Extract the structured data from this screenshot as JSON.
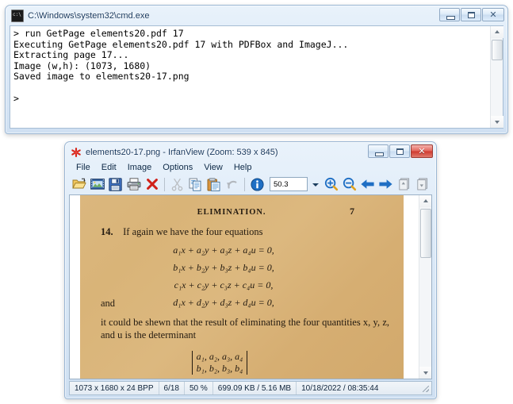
{
  "cmd_window": {
    "title": "C:\\Windows\\system32\\cmd.exe",
    "icon": "cmd-console-icon",
    "buttons": {
      "minimize": "–",
      "maximize": "☐",
      "close": "✕"
    },
    "console_text": "> run GetPage elements20.pdf 17\nExecuting GetPage elements20.pdf 17 with PDFBox and ImageJ...\nExtracting page 17...\nImage (w,h): (1073, 1680)\nSaved image to elements20-17.png\n\n>"
  },
  "irfanview_window": {
    "title": "elements20-17.png - IrfanView (Zoom: 539 x 845)",
    "icon": "irfanview-starburst-icon",
    "buttons": {
      "minimize": "–",
      "maximize": "☐",
      "close": "✕"
    },
    "menu": [
      {
        "label": "File"
      },
      {
        "label": "Edit"
      },
      {
        "label": "Image"
      },
      {
        "label": "Options"
      },
      {
        "label": "View"
      },
      {
        "label": "Help"
      }
    ],
    "toolbar": {
      "zoom_value": "50.3",
      "buttons": [
        {
          "name": "open-icon"
        },
        {
          "name": "thumbnails-icon"
        },
        {
          "name": "save-icon"
        },
        {
          "name": "print-icon"
        },
        {
          "name": "delete-icon"
        },
        {
          "name": "cut-icon"
        },
        {
          "name": "copy-icon"
        },
        {
          "name": "paste-icon"
        },
        {
          "name": "undo-icon"
        },
        {
          "name": "info-icon"
        },
        {
          "name": "zoom-in-icon"
        },
        {
          "name": "zoom-out-icon"
        },
        {
          "name": "previous-icon"
        },
        {
          "name": "next-icon"
        },
        {
          "name": "first-icon"
        },
        {
          "name": "last-icon"
        }
      ]
    },
    "page": {
      "running_head": "ELIMINATION.",
      "page_number": "7",
      "article_number": "14.",
      "intro_text": "If again we have the four equations",
      "equations": [
        "a₁x + a₂y + a₃z + a₄u = 0,",
        "b₁x + b₂y + b₃z + b₄u = 0,",
        "c₁x + c₂y + c₃z + c₄u = 0,",
        "d₁x + d₂y + d₃z + d₄u = 0,"
      ],
      "and_label": "and",
      "body_text": "it could be shewn that the result of eliminating the four quantities x, y, z, and u is the determinant",
      "determinant_rows": [
        "a₁, a₂, a₃, a₄",
        "b₁, b₂, b₃, b₄"
      ]
    },
    "statusbar": {
      "dimensions": "1073 x 1680 x 24 BPP",
      "index": "6/18",
      "zoom": "50 %",
      "size": "699.09 KB / 5.16 MB",
      "datetime": "10/18/2022 / 08:35:44"
    }
  }
}
